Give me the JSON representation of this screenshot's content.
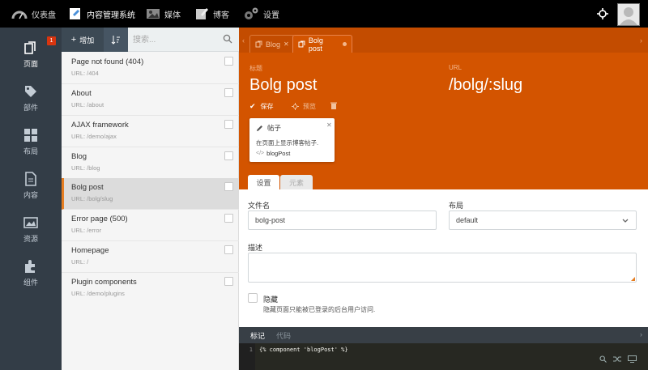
{
  "topbar": {
    "items": [
      {
        "label": "仪表盘",
        "icon": "dashboard-icon"
      },
      {
        "label": "内容管理系统",
        "icon": "cms-icon"
      },
      {
        "label": "媒体",
        "icon": "media-icon"
      },
      {
        "label": "博客",
        "icon": "blog-icon"
      },
      {
        "label": "设置",
        "icon": "settings-icon"
      }
    ]
  },
  "sidenav": {
    "items": [
      {
        "label": "页面",
        "icon": "pages-icon"
      },
      {
        "label": "部件",
        "icon": "partials-icon"
      },
      {
        "label": "布局",
        "icon": "layouts-icon"
      },
      {
        "label": "内容",
        "icon": "content-icon"
      },
      {
        "label": "资源",
        "icon": "assets-icon"
      },
      {
        "label": "组件",
        "icon": "components-icon"
      }
    ],
    "badge": "1"
  },
  "list": {
    "add_label": "增加",
    "search_placeholder": "搜索...",
    "items": [
      {
        "title": "Page not found (404)",
        "url": "URL: /404"
      },
      {
        "title": "About",
        "url": "URL: /about"
      },
      {
        "title": "AJAX framework",
        "url": "URL: /demo/ajax"
      },
      {
        "title": "Blog",
        "url": "URL: /blog"
      },
      {
        "title": "Bolg post",
        "url": "URL: /bolg/slug"
      },
      {
        "title": "Error page (500)",
        "url": "URL: /error"
      },
      {
        "title": "Homepage",
        "url": "URL: /"
      },
      {
        "title": "Plugin components",
        "url": "URL: /demo/plugins"
      }
    ]
  },
  "editor_tabs": {
    "inactive_label": "Blog",
    "active_label": "Bolg post"
  },
  "form": {
    "title_label": "标题",
    "title_value": "Bolg post",
    "url_label": "URL",
    "url_value": "/bolg/:slug",
    "save_label": "保存",
    "preview_label": "预览",
    "component": {
      "name": "帖子",
      "description": "在页面上显示博客帖子.",
      "alias": "blogPost"
    },
    "tab_settings": "设置",
    "tab_markup": "元素",
    "filename_label": "文件名",
    "filename_value": "bolg-post",
    "layout_label": "布局",
    "layout_value": "default",
    "description_label": "描述",
    "hidden_label": "隐藏",
    "hidden_help": "隐藏页面只能被已登录的后台用户访问."
  },
  "code_editor": {
    "tab_markup": "标记",
    "tab_code": "代码",
    "line_number": "1",
    "code": "{% component 'blogPost' %}"
  },
  "colors": {
    "accent": "#d35400",
    "sidebar": "#333d47",
    "topbar": "#000000"
  }
}
